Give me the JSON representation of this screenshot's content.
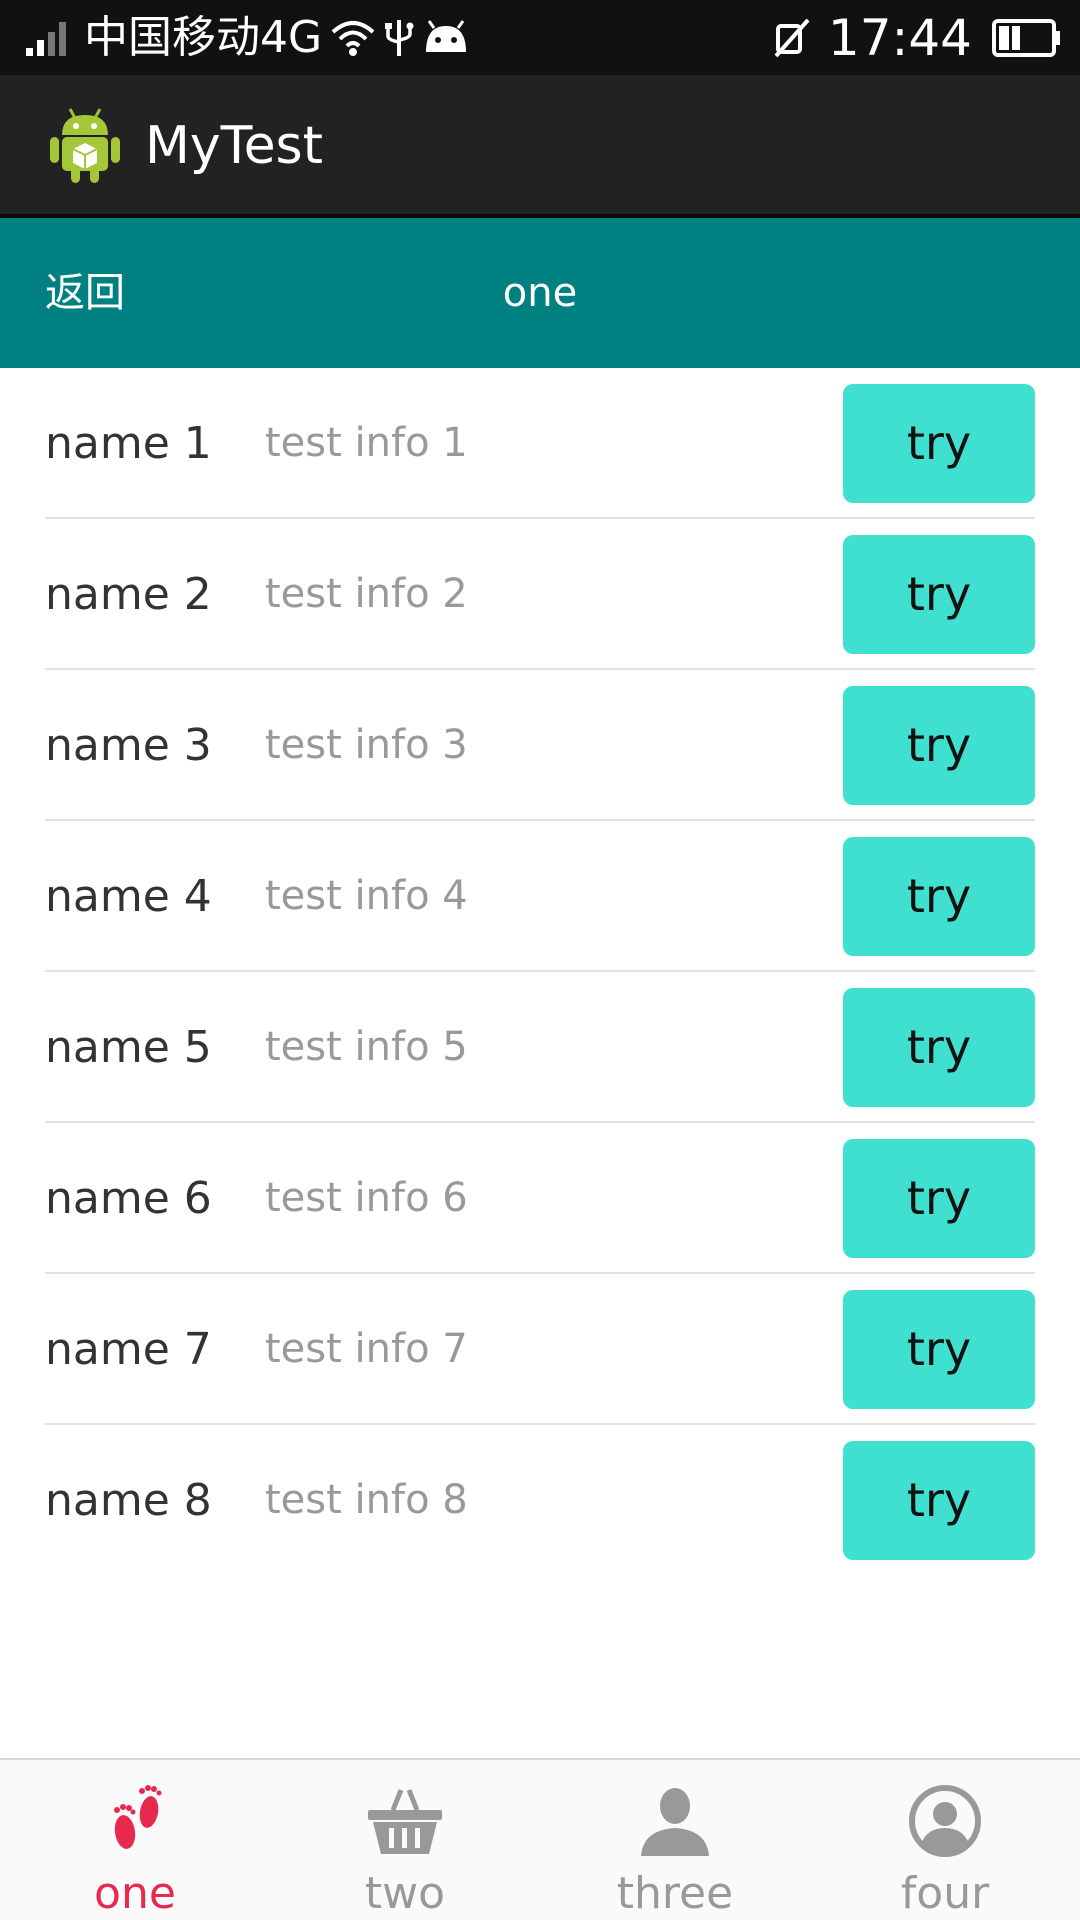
{
  "status_bar": {
    "carrier": "中国移动4G",
    "time": "17:44",
    "icons": [
      "signal-icon",
      "wifi-icon",
      "usb-icon",
      "android-debug-icon",
      "mute-icon",
      "battery-icon"
    ]
  },
  "action_bar": {
    "app_title": "MyTest",
    "logo_icon": "android-app-icon"
  },
  "title_bar": {
    "back_label": "返回",
    "title": "one",
    "background_color": "#008080"
  },
  "list": {
    "button_color": "#40e0d0",
    "items": [
      {
        "name": "name 1",
        "info": "test info 1",
        "button": "try"
      },
      {
        "name": "name 2",
        "info": "test info 2",
        "button": "try"
      },
      {
        "name": "name 3",
        "info": "test info 3",
        "button": "try"
      },
      {
        "name": "name 4",
        "info": "test info 4",
        "button": "try"
      },
      {
        "name": "name 5",
        "info": "test info 5",
        "button": "try"
      },
      {
        "name": "name 6",
        "info": "test info 6",
        "button": "try"
      },
      {
        "name": "name 7",
        "info": "test info 7",
        "button": "try"
      },
      {
        "name": "name 8",
        "info": "test info 8",
        "button": "try"
      }
    ]
  },
  "bottom_nav": {
    "active_color": "#e8294e",
    "inactive_color": "#999999",
    "tabs": [
      {
        "label": "one",
        "icon": "footprints-icon",
        "active": true
      },
      {
        "label": "two",
        "icon": "basket-icon",
        "active": false
      },
      {
        "label": "three",
        "icon": "person-icon",
        "active": false
      },
      {
        "label": "four",
        "icon": "user-circle-icon",
        "active": false
      }
    ]
  }
}
